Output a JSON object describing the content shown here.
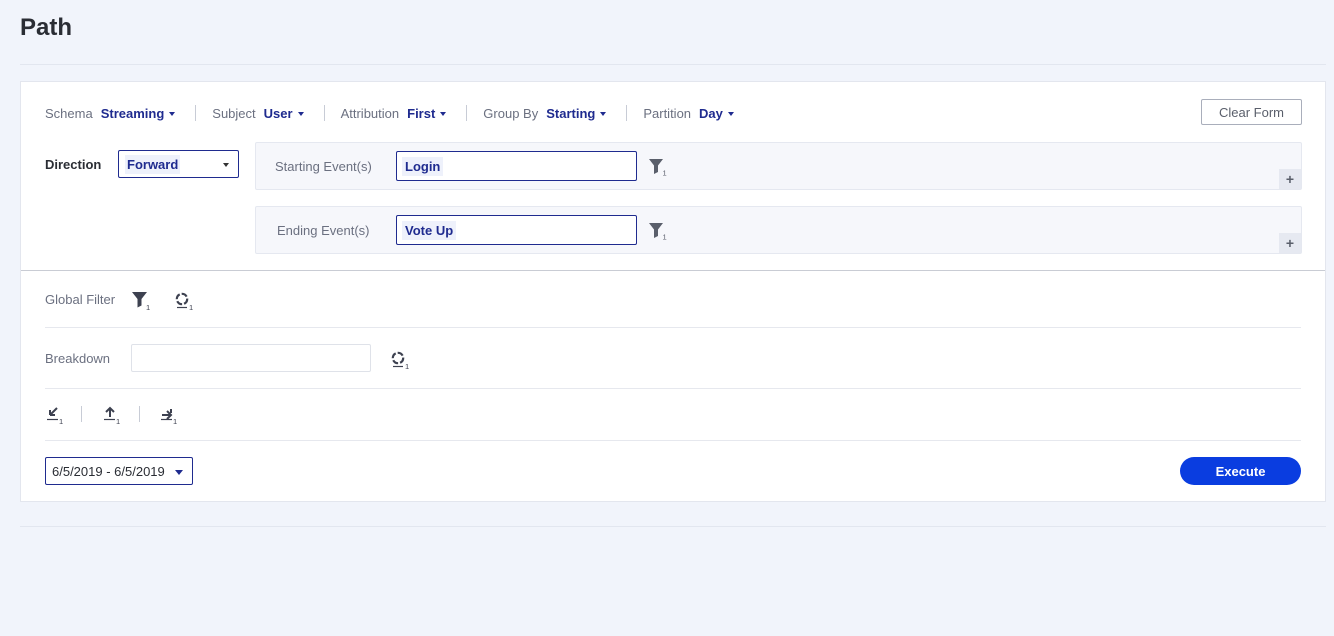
{
  "page": {
    "title": "Path"
  },
  "selectors": [
    {
      "label": "Schema",
      "value": "Streaming"
    },
    {
      "label": "Subject",
      "value": "User"
    },
    {
      "label": "Attribution",
      "value": "First"
    },
    {
      "label": "Group By",
      "value": "Starting"
    },
    {
      "label": "Partition",
      "value": "Day"
    }
  ],
  "clear_button": "Clear Form",
  "direction": {
    "label": "Direction",
    "value": "Forward"
  },
  "starting_event": {
    "label": "Starting Event(s)",
    "value": "Login",
    "filter_count": "1",
    "add": "+"
  },
  "ending_event": {
    "label": "Ending Event(s)",
    "value": "Vote Up",
    "filter_count": "1",
    "add": "+"
  },
  "global_filter": {
    "label": "Global Filter",
    "filter_count": "1",
    "segment_count": "1"
  },
  "breakdown": {
    "label": "Breakdown",
    "value": "",
    "segment_count": "1"
  },
  "actions": {
    "counts": [
      "1",
      "1",
      "1"
    ]
  },
  "date_range": {
    "value": "6/5/2019 - 6/5/2019"
  },
  "execute_button": "Execute",
  "colors": {
    "accent": "#1f2b8f",
    "primary_button": "#0a3de0",
    "background": "#f1f4fb"
  }
}
